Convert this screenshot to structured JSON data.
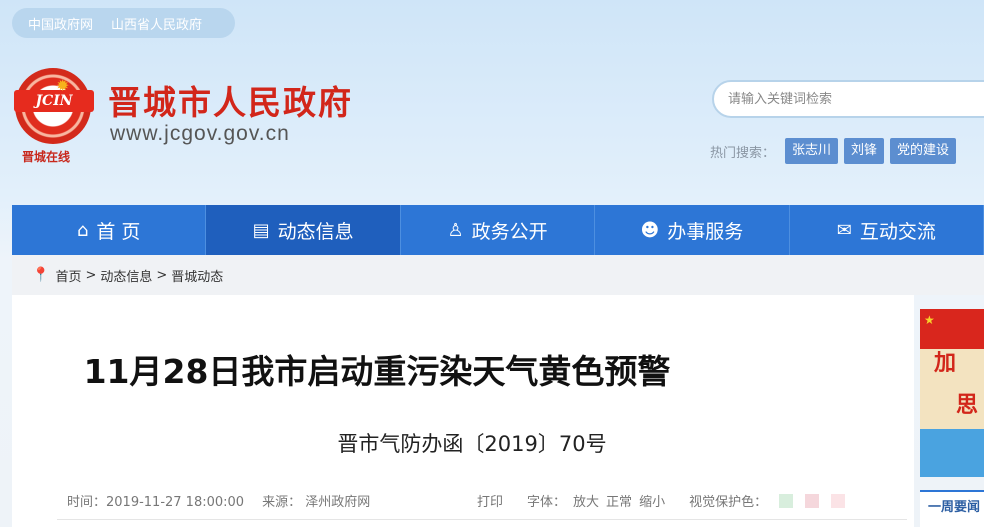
{
  "top_links": [
    "中国政府网",
    "山西省人民政府"
  ],
  "logo": {
    "text": "JCIN",
    "subtitle": "晋城在线"
  },
  "site": {
    "title": "晋城市人民政府",
    "url": "www.jcgov.gov.cn"
  },
  "search": {
    "placeholder": "请输入关键词检索"
  },
  "hot_search": {
    "label": "热门搜索：",
    "tags": [
      "张志川",
      "刘锋",
      "党的建设"
    ]
  },
  "nav": [
    {
      "label": "首 页",
      "icon": "home-icon"
    },
    {
      "label": "动态信息",
      "icon": "news-icon"
    },
    {
      "label": "政务公开",
      "icon": "person-icon"
    },
    {
      "label": "办事服务",
      "icon": "group-icon"
    },
    {
      "label": "互动交流",
      "icon": "chat-icon"
    }
  ],
  "breadcrumb": [
    "首页",
    "动态信息",
    "晋城动态"
  ],
  "article": {
    "title": "11月28日我市启动重污染天气黄色预警",
    "doc_number": "晋市气防办函〔2019〕70号",
    "time": "时间：2019-11-27 18:00:00",
    "source": "来源：  泽州政府网",
    "print": "打印",
    "font_label": "字体：",
    "font_large": "放大",
    "font_normal": "正常",
    "font_small": "缩小",
    "eye_label": "视觉保护色："
  },
  "colors": {
    "nav": "#2d76d6",
    "swatches": [
      "#d8eedd",
      "#f5d7dc",
      "#fbe3e6"
    ]
  },
  "banner": {
    "text1": "加",
    "text2": "思"
  },
  "weekly": "一周要闻"
}
